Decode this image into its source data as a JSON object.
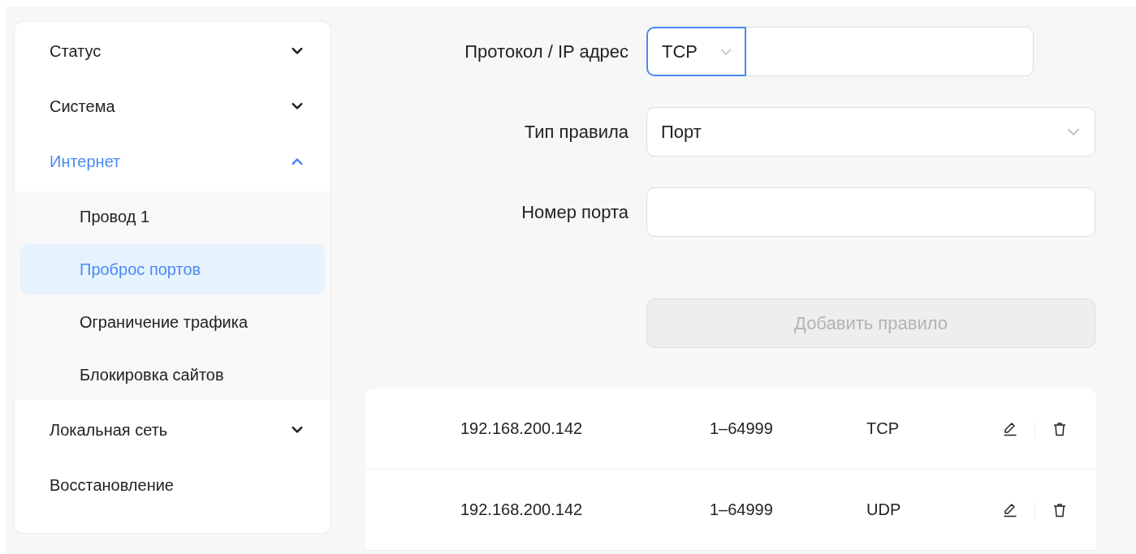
{
  "sidebar": {
    "items": [
      {
        "label": "Статус",
        "expanded": false,
        "selected": false
      },
      {
        "label": "Система",
        "expanded": false,
        "selected": false
      },
      {
        "label": "Интернет",
        "expanded": true,
        "selected": true,
        "children": [
          {
            "label": "Провод 1",
            "selected": false
          },
          {
            "label": "Проброс портов",
            "selected": true
          },
          {
            "label": "Ограничение трафика",
            "selected": false
          },
          {
            "label": "Блокировка сайтов",
            "selected": false
          }
        ]
      },
      {
        "label": "Локальная сеть",
        "expanded": false,
        "selected": false
      },
      {
        "label": "Восстановление",
        "selected": false
      }
    ]
  },
  "form": {
    "fields": [
      {
        "kind": "protocol_ip",
        "label": "Протокол / IP адрес",
        "value": "TCP",
        "focused": true
      },
      {
        "kind": "select",
        "label": "Тип правила",
        "value": "Порт",
        "focused": false
      },
      {
        "kind": "input",
        "label": "Номер порта",
        "focused": false
      }
    ],
    "button": {
      "label": "Добавить правило",
      "disabled": true
    }
  },
  "rules": [
    {
      "ip": "192.168.200.142",
      "ports": "1–64999",
      "protocol": "TCP"
    },
    {
      "ip": "192.168.200.142",
      "ports": "1–64999",
      "protocol": "UDP"
    }
  ]
}
